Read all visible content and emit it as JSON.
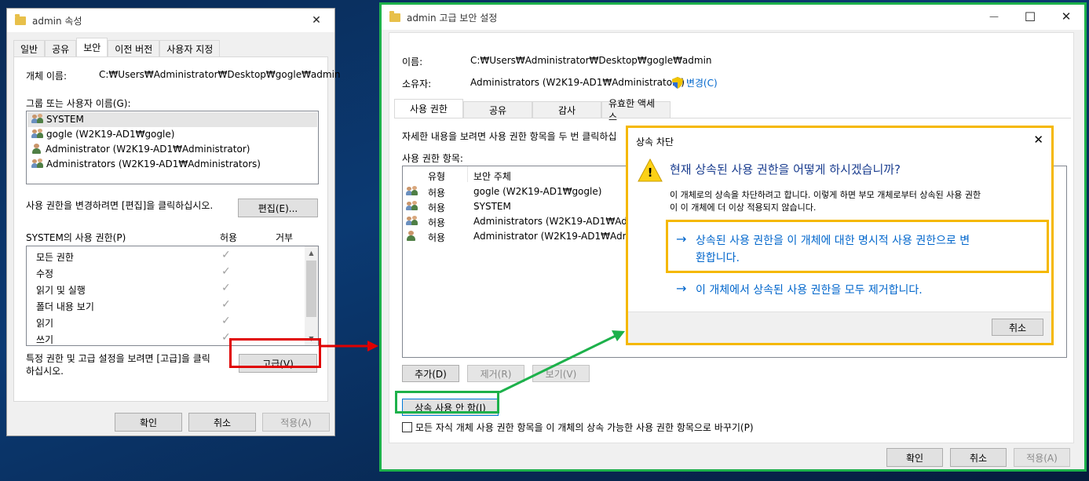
{
  "props_window": {
    "title": "admin 속성",
    "close_glyph": "✕",
    "tabs": [
      "일반",
      "공유",
      "보안",
      "이전 버전",
      "사용자 지정"
    ],
    "object_name_label": "개체 이름:",
    "object_name_value": "C:₩Users₩Administrator₩Desktop₩gogle₩admin",
    "groups_label": "그룹 또는 사용자 이름(G):",
    "users": [
      {
        "name": "SYSTEM",
        "icon": "group-icon"
      },
      {
        "name": "gogle (W2K19-AD1₩gogle)",
        "icon": "group-icon"
      },
      {
        "name": "Administrator (W2K19-AD1₩Administrator)",
        "icon": "user-icon"
      },
      {
        "name": "Administrators (W2K19-AD1₩Administrators)",
        "icon": "group-icon"
      }
    ],
    "change_hint": "사용 권한을 변경하려면 [편집]을 클릭하십시오.",
    "edit_button": "편집(E)...",
    "perm_label": "SYSTEM의 사용 권한(P)",
    "allow_header": "허용",
    "deny_header": "거부",
    "permissions": [
      {
        "name": "모든 권한",
        "allow": "✓"
      },
      {
        "name": "수정",
        "allow": "✓"
      },
      {
        "name": "읽기 및 실행",
        "allow": "✓"
      },
      {
        "name": "폴더 내용 보기",
        "allow": "✓"
      },
      {
        "name": "읽기",
        "allow": "✓"
      },
      {
        "name": "쓰기",
        "allow": "✓"
      }
    ],
    "advanced_hint_line1": "특정 권한 및 고급 설정을 보려면 [고급]을 클릭",
    "advanced_hint_line2": "하십시오.",
    "advanced_button": "고급(V)",
    "ok_button": "확인",
    "cancel_button": "취소",
    "apply_button": "적용(A)"
  },
  "adv_window": {
    "title": "admin 고급 보안 설정",
    "minimize_glyph": "—",
    "maximize_glyph": "☐",
    "close_glyph": "✕",
    "name_label": "이름:",
    "name_value": "C:₩Users₩Administrator₩Desktop₩gogle₩admin",
    "owner_label": "소유자:",
    "owner_value": "Administrators (W2K19-AD1₩Administrators)",
    "change_link": "변경(C)",
    "tabs": [
      "사용 권한",
      "공유",
      "감사",
      "유효한 액세스"
    ],
    "detail_hint": "자세한 내용을 보려면 사용 권한 항목을 두 번 클릭하십",
    "entries_label": "사용 권한 항목:",
    "col_type": "유형",
    "col_principal": "보안 주체",
    "entries": [
      {
        "type": "허용",
        "principal": "gogle (W2K19-AD1₩gogle)",
        "icon": "group-icon"
      },
      {
        "type": "허용",
        "principal": "SYSTEM",
        "icon": "group-icon"
      },
      {
        "type": "허용",
        "principal": "Administrators (W2K19-AD1₩Adm...",
        "icon": "group-icon"
      },
      {
        "type": "허용",
        "principal": "Administrator (W2K19-AD1₩Admi...",
        "icon": "user-icon"
      }
    ],
    "add_button": "추가(D)",
    "remove_button": "제거(R)",
    "view_button": "보기(V)",
    "disable_inheritance_button": "상속 사용 안 함(I)",
    "replace_checkbox_label": "모든 자식 개체 사용 권한 항목을 이 개체의 상속 가능한 사용 권한 항목으로 바꾸기(P)",
    "ok_button": "확인",
    "cancel_button": "취소",
    "apply_button": "적용(A)"
  },
  "block_dialog": {
    "title": "상속 차단",
    "close_glyph": "✕",
    "question": "현재 상속된 사용 권한을 어떻게 하시겠습니까?",
    "description_line1": "이 개체로의 상속을 차단하려고 합니다. 이렇게 하면 부모 개체로부터 상속된 사용 권한",
    "description_line2": "이 이 개체에 더 이상 적용되지 않습니다.",
    "option1_line1": "상속된 사용 권한을 이 개체에 대한 명시적 사용 권한으로 변",
    "option1_line2": "환합니다.",
    "option2": "이 개체에서 상속된 사용 권한을 모두 제거합니다.",
    "arrow_glyph": "→",
    "warning_glyph": "!",
    "cancel_button": "취소"
  },
  "colors": {
    "accent_blue": "#0066cc",
    "highlight_red": "#e00000",
    "highlight_green": "#1db14b",
    "highlight_yellow": "#f5b800"
  }
}
